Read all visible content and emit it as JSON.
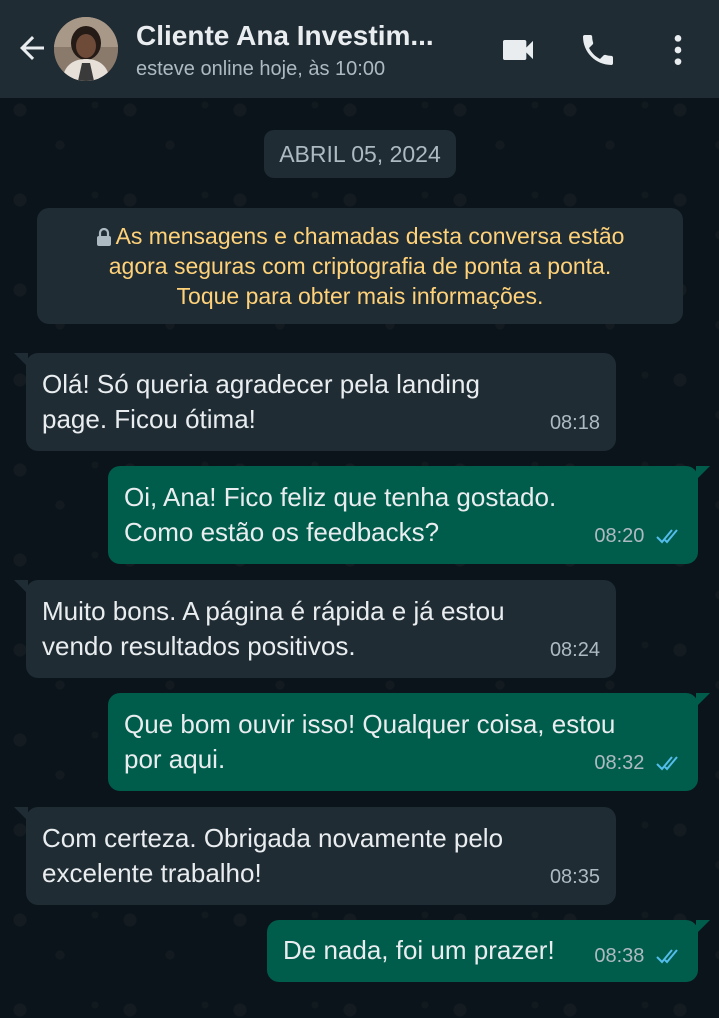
{
  "header": {
    "back_icon": "arrow-left-icon",
    "contact_name": "Cliente Ana Investim...",
    "status": "esteve online hoje, às 10:00",
    "icons": [
      "video-call-icon",
      "phone-icon",
      "more-vert-icon"
    ]
  },
  "chat": {
    "date_chip": "ABRIL 05, 2024",
    "encryption_notice": {
      "icon": "lock-icon",
      "line1": "As mensagens e chamadas desta conversa estão",
      "line2": "agora seguras com criptografia de ponta a ponta.",
      "line3": "Toque para obter mais informações."
    },
    "messages": [
      {
        "direction": "incoming",
        "line1": "Olá! Só queria agradecer pela landing",
        "line2": "page. Ficou ótima!",
        "time": "08:18"
      },
      {
        "direction": "outgoing",
        "line1": "Oi, Ana! Fico feliz que tenha gostado.",
        "line2": "Como estão os feedbacks?",
        "time": "08:20",
        "status": "read"
      },
      {
        "direction": "incoming",
        "line1": "Muito bons. A página é rápida e já estou",
        "line2": "vendo resultados positivos.",
        "time": "08:24"
      },
      {
        "direction": "outgoing",
        "line1": "Que bom ouvir isso! Qualquer coisa, estou",
        "line2": "por aqui.",
        "time": "08:32",
        "status": "read"
      },
      {
        "direction": "incoming",
        "line1": "Com certeza. Obrigada novamente pelo",
        "line2": "excelente trabalho!",
        "time": "08:35"
      },
      {
        "direction": "outgoing",
        "line1": "De nada, foi um prazer!",
        "time": "08:38",
        "status": "read"
      }
    ]
  },
  "colors": {
    "header_bg": "#1f2c34",
    "chat_bg": "#0b141a",
    "incoming_bubble": "#1f2c34",
    "outgoing_bubble": "#005c4b",
    "notice_text": "#ffd279",
    "read_ticks": "#53bdeb"
  }
}
